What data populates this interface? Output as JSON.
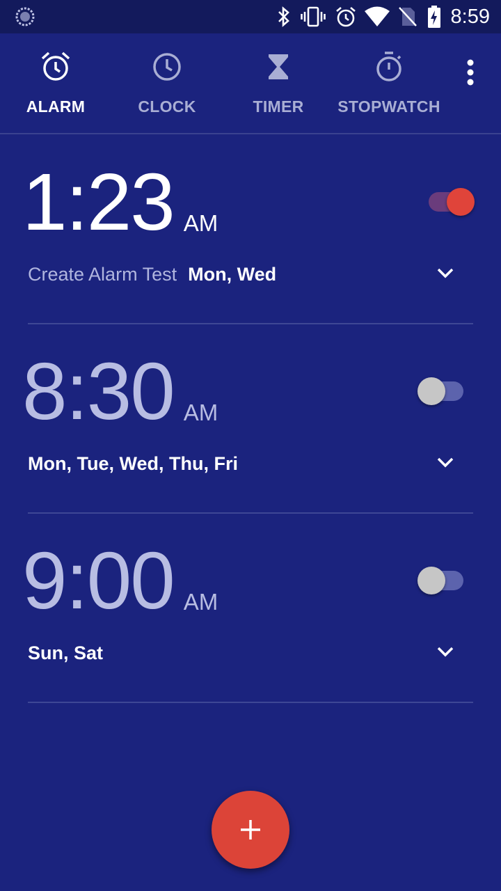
{
  "status_bar": {
    "time": "8:59",
    "icons": [
      "loading-icon",
      "bluetooth-icon",
      "vibrate-icon",
      "alarm-icon",
      "wifi-icon",
      "no-sim-icon",
      "battery-charging-icon"
    ]
  },
  "tabs": [
    {
      "label": "ALARM",
      "icon": "alarm-clock-icon",
      "active": true
    },
    {
      "label": "CLOCK",
      "icon": "clock-icon",
      "active": false
    },
    {
      "label": "TIMER",
      "icon": "hourglass-icon",
      "active": false
    },
    {
      "label": "STOPWATCH",
      "icon": "stopwatch-icon",
      "active": false
    }
  ],
  "alarms": [
    {
      "time": "1:23",
      "ampm": "AM",
      "label": "Create Alarm Test",
      "days": "Mon, Wed",
      "enabled": true
    },
    {
      "time": "8:30",
      "ampm": "AM",
      "label": "",
      "days": "Mon, Tue, Wed, Thu, Fri",
      "enabled": false
    },
    {
      "time": "9:00",
      "ampm": "AM",
      "label": "",
      "days": "Sun, Sat",
      "enabled": false
    }
  ],
  "colors": {
    "background": "#1b237e",
    "status_bar": "#131a5c",
    "accent": "#dc4438",
    "tab_inactive": "#a9aed4"
  },
  "fab": {
    "icon": "plus-icon"
  }
}
